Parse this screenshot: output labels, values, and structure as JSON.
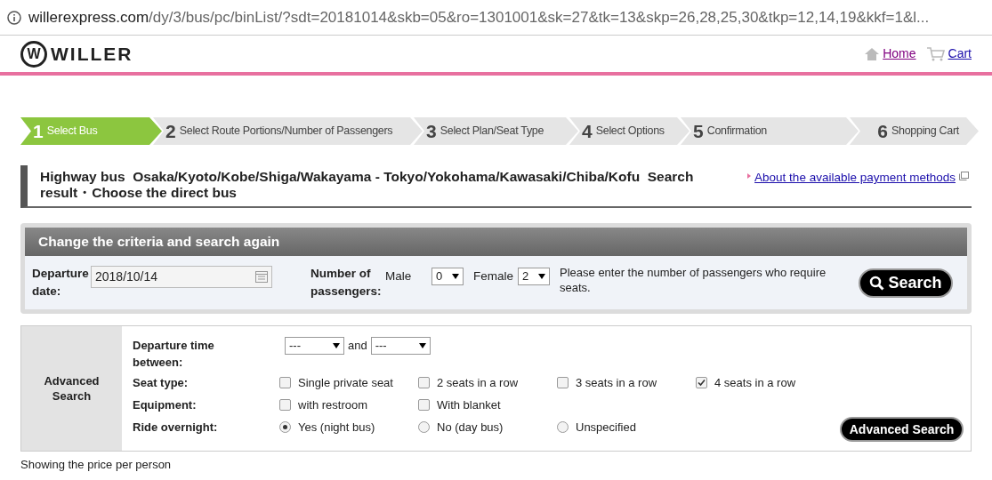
{
  "address_bar": {
    "host": "willerexpress.com",
    "path": "/dy/3/bus/pc/binList/?sdt=20181014&skb=05&ro=1301001&sk=27&tk=13&skp=26,28,25,30&tkp=12,14,19&kkf=1&l..."
  },
  "header": {
    "logo_letter": "W",
    "logo_text": "WILLER",
    "links": [
      {
        "label": "Home",
        "visited": true
      },
      {
        "label": "Cart",
        "visited": false
      }
    ]
  },
  "steps": [
    {
      "number": "1",
      "label": "Select Bus",
      "selected": true
    },
    {
      "number": "2",
      "label": "Select Route Portions/Number of Passengers",
      "selected": false
    },
    {
      "number": "3",
      "label": "Select Plan/Seat Type",
      "selected": false
    },
    {
      "number": "4",
      "label": "Select Options",
      "selected": false
    },
    {
      "number": "5",
      "label": "Confirmation",
      "selected": false
    },
    {
      "number": "6",
      "label": "Shopping Cart",
      "selected": false
    }
  ],
  "page_title": "Highway bus  Osaka/Kyoto/Kobe/Shiga/Wakayama - Tokyo/Yokohama/Kawasaki/Chiba/Kofu  Search result・Choose the direct bus",
  "payment_link": "About the available payment methods",
  "search_panel": {
    "title": "Change the criteria and search again",
    "departure_label": "Departure date:",
    "departure_value": "2018/10/14",
    "passengers_label": "Number of passengers:",
    "male_label": "Male",
    "male_value": "0",
    "female_label": "Female",
    "female_value": "2",
    "note": "Please enter the number of passengers who require seats.",
    "button": "Search"
  },
  "advanced": {
    "heading": "Advanced Search",
    "time_label": "Departure time between:",
    "time_from": "---",
    "time_joiner": "and",
    "time_to": "---",
    "rows": [
      {
        "label": "Seat type:",
        "options": [
          {
            "kind": "checkbox",
            "label": "Single private seat",
            "checked": false
          },
          {
            "kind": "checkbox",
            "label": "2 seats in a row",
            "checked": false
          },
          {
            "kind": "checkbox",
            "label": "3 seats in a row",
            "checked": false
          },
          {
            "kind": "checkbox",
            "label": "4 seats in a row",
            "checked": true
          }
        ]
      },
      {
        "label": "Equipment:",
        "options": [
          {
            "kind": "checkbox",
            "label": "with restroom",
            "checked": false
          },
          {
            "kind": "checkbox",
            "label": "With blanket",
            "checked": false
          }
        ]
      },
      {
        "label": "Ride overnight:",
        "options": [
          {
            "kind": "radio",
            "label": "Yes (night bus)",
            "checked": true
          },
          {
            "kind": "radio",
            "label": "No (day bus)",
            "checked": false
          },
          {
            "kind": "radio",
            "label": "Unspecified",
            "checked": false
          }
        ]
      }
    ],
    "button": "Advanced Search"
  },
  "footer_note": "Showing the price per person"
}
